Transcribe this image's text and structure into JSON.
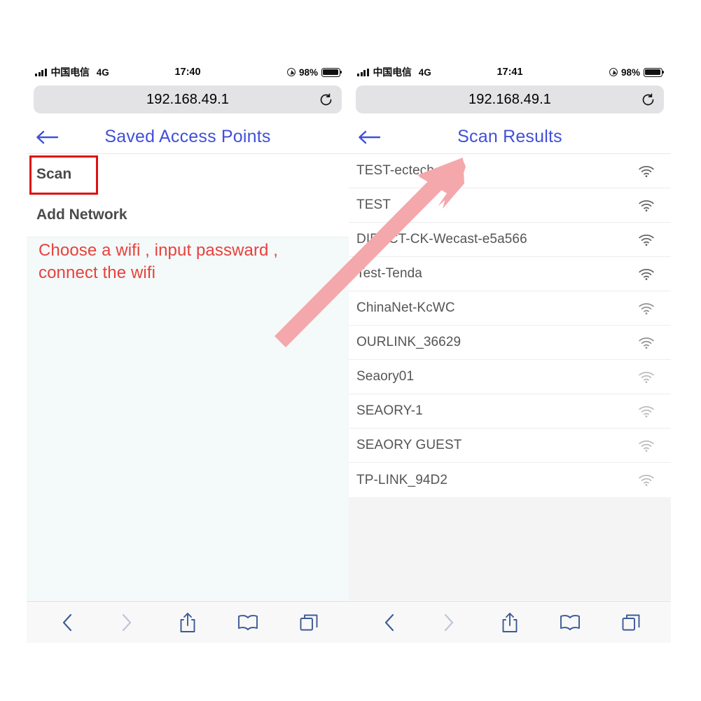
{
  "status_bar": {
    "carrier": "中国电信",
    "network_type": "4G",
    "time_left": "17:40",
    "time_right": "17:41",
    "battery_percent": "98%",
    "signal_icon": "cellular-signal-icon",
    "location_icon": "location-services-icon",
    "battery_icon": "battery-icon"
  },
  "browser": {
    "url": "192.168.49.1",
    "reload_icon": "reload-icon",
    "toolbar": {
      "back_icon": "chevron-left-icon",
      "forward_icon": "chevron-right-icon",
      "share_icon": "share-icon",
      "bookmarks_icon": "book-icon",
      "tabs_icon": "tabs-icon"
    }
  },
  "left_panel": {
    "header": {
      "title": "Saved Access Points",
      "back_icon": "arrow-left-icon"
    },
    "menu": [
      {
        "label": "Scan",
        "highlighted": true
      },
      {
        "label": "Add Network",
        "highlighted": false
      }
    ],
    "annotation": "Choose a wifi , input passward , connect the wifi"
  },
  "right_panel": {
    "header": {
      "title": "Scan Results",
      "back_icon": "arrow-left-icon"
    },
    "networks": [
      {
        "ssid": "TEST-ectech",
        "signal": "strong"
      },
      {
        "ssid": "TEST",
        "signal": "strong"
      },
      {
        "ssid": "DIRECT-CK-Wecast-e5a566",
        "signal": "strong"
      },
      {
        "ssid": "Test-Tenda",
        "signal": "strong"
      },
      {
        "ssid": "ChinaNet-KcWC",
        "signal": "medium"
      },
      {
        "ssid": "OURLINK_36629",
        "signal": "medium"
      },
      {
        "ssid": "Seaory01",
        "signal": "weak"
      },
      {
        "ssid": "SEAORY-1",
        "signal": "weak"
      },
      {
        "ssid": "SEAORY GUEST",
        "signal": "weak"
      },
      {
        "ssid": "TP-LINK_94D2",
        "signal": "weak"
      }
    ]
  },
  "colors": {
    "header_blue": "#4150d8",
    "annotation_red": "#e8413c",
    "highlight_box_red": "#dd1111",
    "arrow_pink": "#f4a8ab",
    "toolbar_blue": "#3b5a96"
  }
}
